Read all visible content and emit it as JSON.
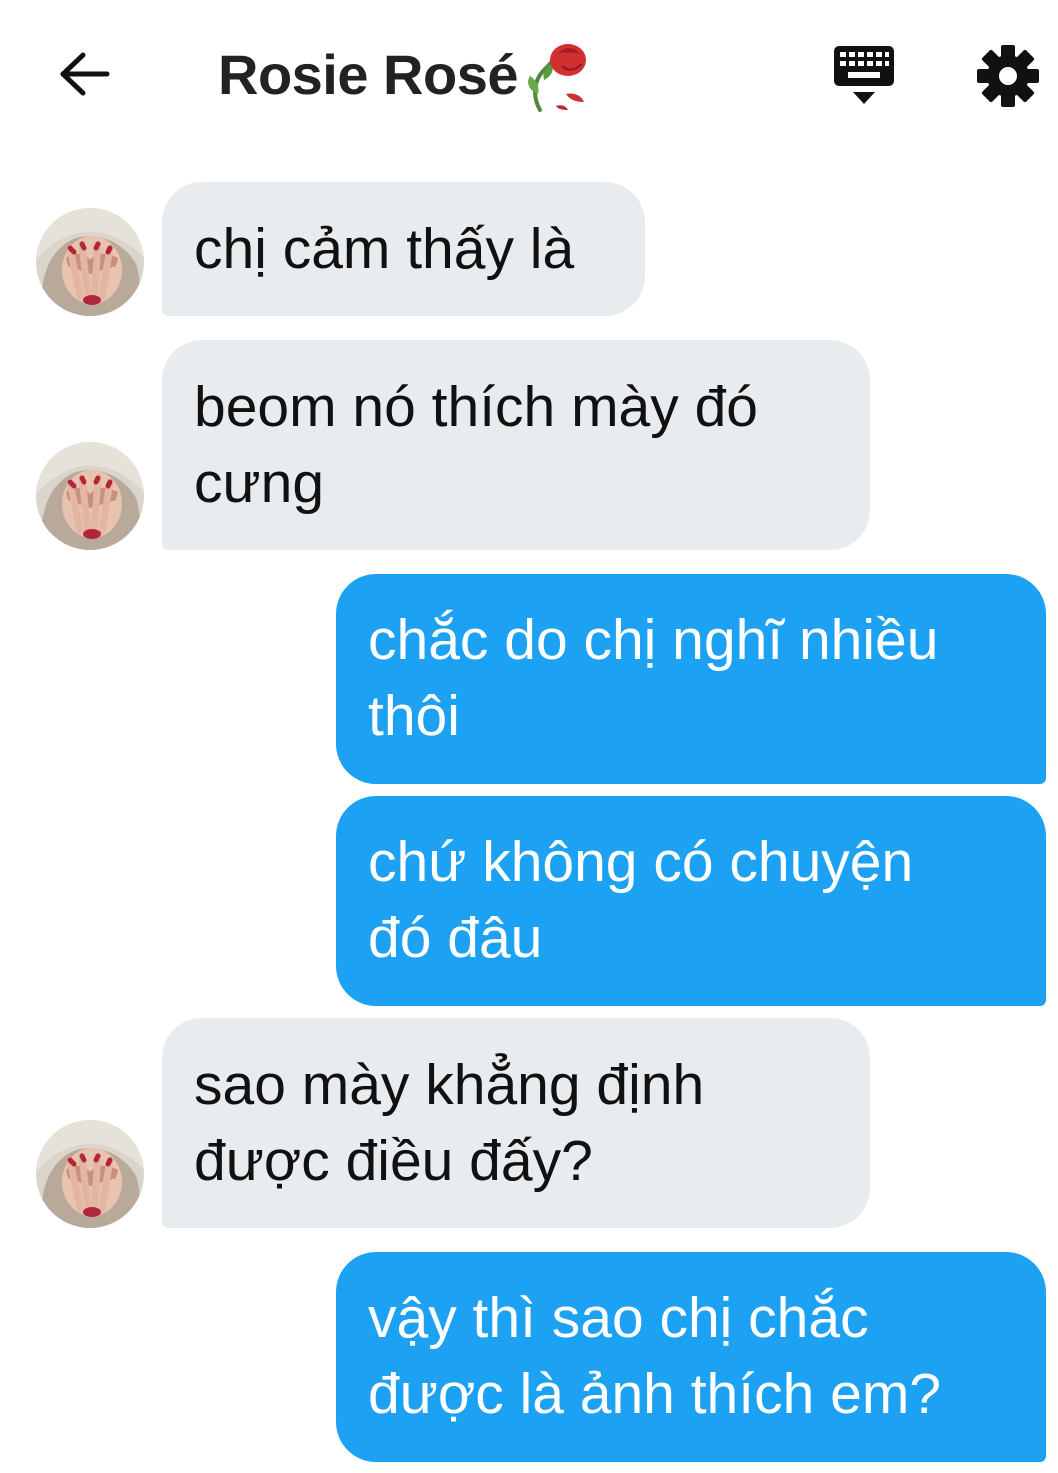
{
  "header": {
    "title": "Rosie Rosé",
    "back_icon": "arrow-left-icon",
    "title_icon": "wilted-rose-icon",
    "keyboard_icon": "keyboard-icon",
    "settings_icon": "gear-icon"
  },
  "colors": {
    "incoming_bubble": "#e9ecef",
    "outgoing_bubble": "#1da1f2",
    "text_dark": "#111111",
    "text_light": "#ffffff"
  },
  "messages": [
    {
      "direction": "incoming",
      "text": "chị cảm thấy là"
    },
    {
      "direction": "incoming",
      "text": "beom nó thích mày đó\ncưng"
    },
    {
      "direction": "outgoing",
      "text": "chắc do chị nghĩ nhiều\nthôi"
    },
    {
      "direction": "outgoing",
      "text": "chứ không có chuyện\nđó đâu"
    },
    {
      "direction": "incoming",
      "text": "sao mày khẳng định\nđược điều đấy?"
    },
    {
      "direction": "outgoing",
      "text": "vậy thì sao chị chắc\nđược là ảnh thích em?"
    }
  ]
}
